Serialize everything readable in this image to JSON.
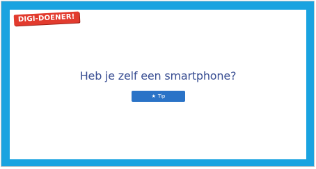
{
  "brand": {
    "logo_text": "DIGI-DOENER!"
  },
  "main": {
    "question": "Heb je zelf een smartphone?",
    "tip_button": {
      "icon": "star-icon",
      "label": "Tip"
    }
  },
  "colors": {
    "frame": "#1aa3e0",
    "question_text": "#3a4f93",
    "button": "#2a73c7",
    "logo": "#e23b2e"
  }
}
